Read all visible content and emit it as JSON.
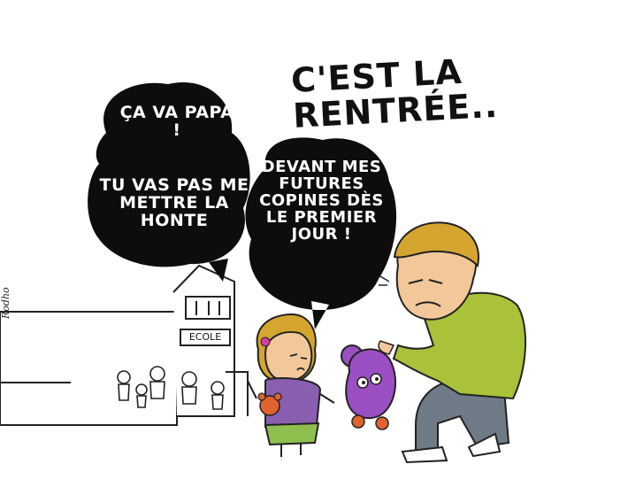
{
  "title": "C'EST LA RENTRÉE..",
  "bubbles": {
    "child_first": "ÇA VA PAPA !",
    "child_second": "TU VAS PAS ME METTRE LA HONTE",
    "child_third": "DEVANT MES FUTURES COPINES DÈS LE PREMIER JOUR !"
  },
  "school_sign": "ECOLE",
  "signature": "Rodho",
  "colors": {
    "bubble": "#0d0d0d",
    "shirt_green": "#a9c23a",
    "pants_gray": "#6f7b86",
    "hair_blond": "#d4a62f",
    "dress_purple": "#8a5fb0",
    "skirt_green": "#8fbf4e",
    "toy_purple": "#9a4fc2",
    "skin": "#f2c89a"
  }
}
